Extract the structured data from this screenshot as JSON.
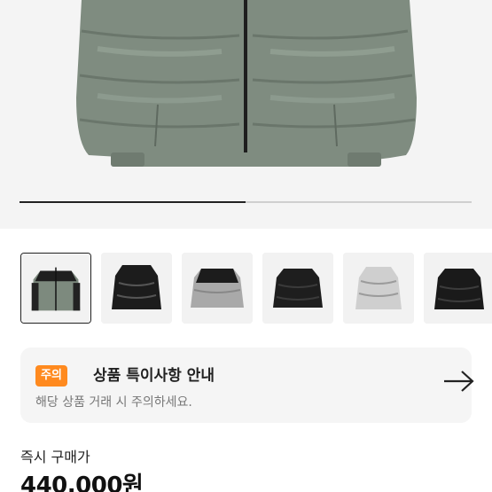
{
  "gallery": {
    "main_image_alt": "green down puffer jacket",
    "progress": 0.5,
    "thumbnails": [
      {
        "name": "thumb-green-black-puffer",
        "selected": true
      },
      {
        "name": "thumb-glossy-black-puffer",
        "selected": false
      },
      {
        "name": "thumb-grey-black-puffer",
        "selected": false
      },
      {
        "name": "thumb-black-puffer",
        "selected": false
      },
      {
        "name": "thumb-silver-puffer",
        "selected": false
      },
      {
        "name": "thumb-black-puffer-2",
        "selected": false
      }
    ]
  },
  "notice": {
    "badge": "주의",
    "title": "상품 특이사항 안내",
    "subtitle": "해당 상품 거래 시 주의하세요.",
    "arrow_icon": "arrow-right-icon",
    "badge_color": "#ff8a1f"
  },
  "purchase": {
    "label": "즉시 구매가",
    "price": "440,000원"
  }
}
